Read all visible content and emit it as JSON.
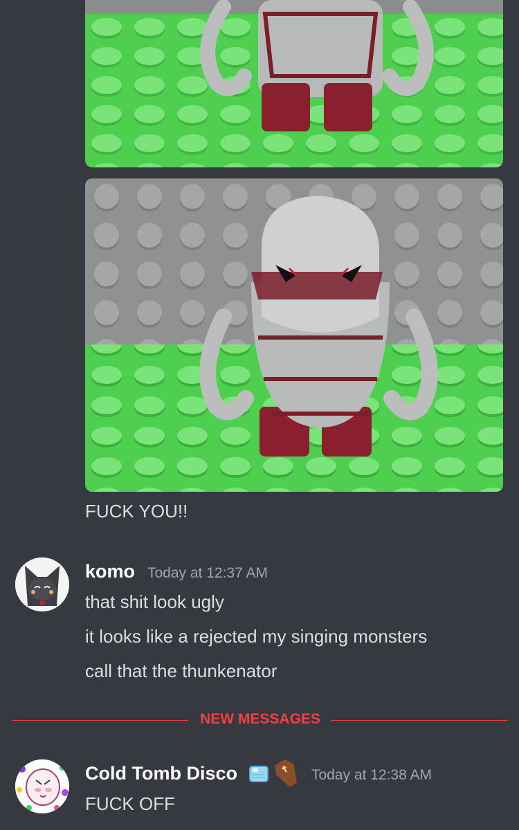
{
  "messages": {
    "prev_caption": "FUCK YOU!!",
    "komo": {
      "username": "komo",
      "timestamp": "Today at 12:37 AM",
      "lines": [
        "that shit look ugly",
        "it looks like a rejected my singing monsters",
        "call that the thunkenator"
      ]
    },
    "divider_label": "NEW MESSAGES",
    "cold": {
      "username": "Cold Tomb Disco",
      "badges": [
        "ice-cube-icon",
        "coffin-icon"
      ],
      "timestamp": "Today at 12:38 AM",
      "text": "FUCK OFF"
    }
  },
  "colors": {
    "background": "#36393f",
    "username": "#ffffff",
    "timestamp": "#a3a6aa",
    "new_messages": "#ed4245"
  }
}
